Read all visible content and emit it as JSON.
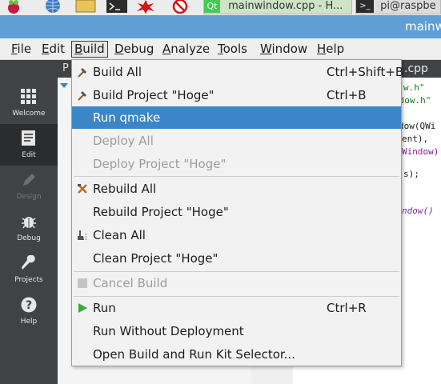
{
  "taskbar": {
    "qt_task": "mainwindow.cpp - H...",
    "terminal_task": "pi@raspbe"
  },
  "window": {
    "title": "mainw"
  },
  "menubar": {
    "items": [
      {
        "prefix": "",
        "key": "F",
        "rest": "ile"
      },
      {
        "prefix": "",
        "key": "E",
        "rest": "dit"
      },
      {
        "prefix": "",
        "key": "B",
        "rest": "uild"
      },
      {
        "prefix": "",
        "key": "D",
        "rest": "ebug"
      },
      {
        "prefix": "",
        "key": "A",
        "rest": "nalyze"
      },
      {
        "prefix": "",
        "key": "T",
        "rest": "ools"
      },
      {
        "prefix": "",
        "key": "W",
        "rest": "indow"
      },
      {
        "prefix": "",
        "key": "H",
        "rest": "elp"
      }
    ]
  },
  "sidebar": {
    "items": [
      {
        "label": "Welcome"
      },
      {
        "label": "Edit"
      },
      {
        "label": "Design"
      },
      {
        "label": "Debug"
      },
      {
        "label": "Projects"
      },
      {
        "label": "Help"
      }
    ]
  },
  "editor": {
    "panel_label": "P",
    "tab_file": ".cpp",
    "code_lines": [
      "w.h\"",
      "ndow.h\"",
      "",
      "dow(QWi",
      "ent),",
      "Window)",
      "",
      "s);",
      "",
      "",
      "ndow()"
    ]
  },
  "build_menu": {
    "items": [
      {
        "label": "Build All",
        "shortcut": "Ctrl+Shift+B"
      },
      {
        "label": "Build Project \"Hoge\"",
        "shortcut": "Ctrl+B"
      },
      {
        "label": "Run qmake",
        "shortcut": ""
      },
      {
        "label": "Deploy All",
        "shortcut": ""
      },
      {
        "label": "Deploy Project \"Hoge\"",
        "shortcut": ""
      },
      {
        "label": "Rebuild All",
        "shortcut": ""
      },
      {
        "label": "Rebuild Project \"Hoge\"",
        "shortcut": ""
      },
      {
        "label": "Clean All",
        "shortcut": ""
      },
      {
        "label": "Clean Project \"Hoge\"",
        "shortcut": ""
      },
      {
        "label": "Cancel Build",
        "shortcut": ""
      },
      {
        "label": "Run",
        "shortcut": "Ctrl+R"
      },
      {
        "label": "Run Without Deployment",
        "shortcut": ""
      },
      {
        "label": "Open Build and Run Kit Selector...",
        "shortcut": ""
      }
    ]
  }
}
